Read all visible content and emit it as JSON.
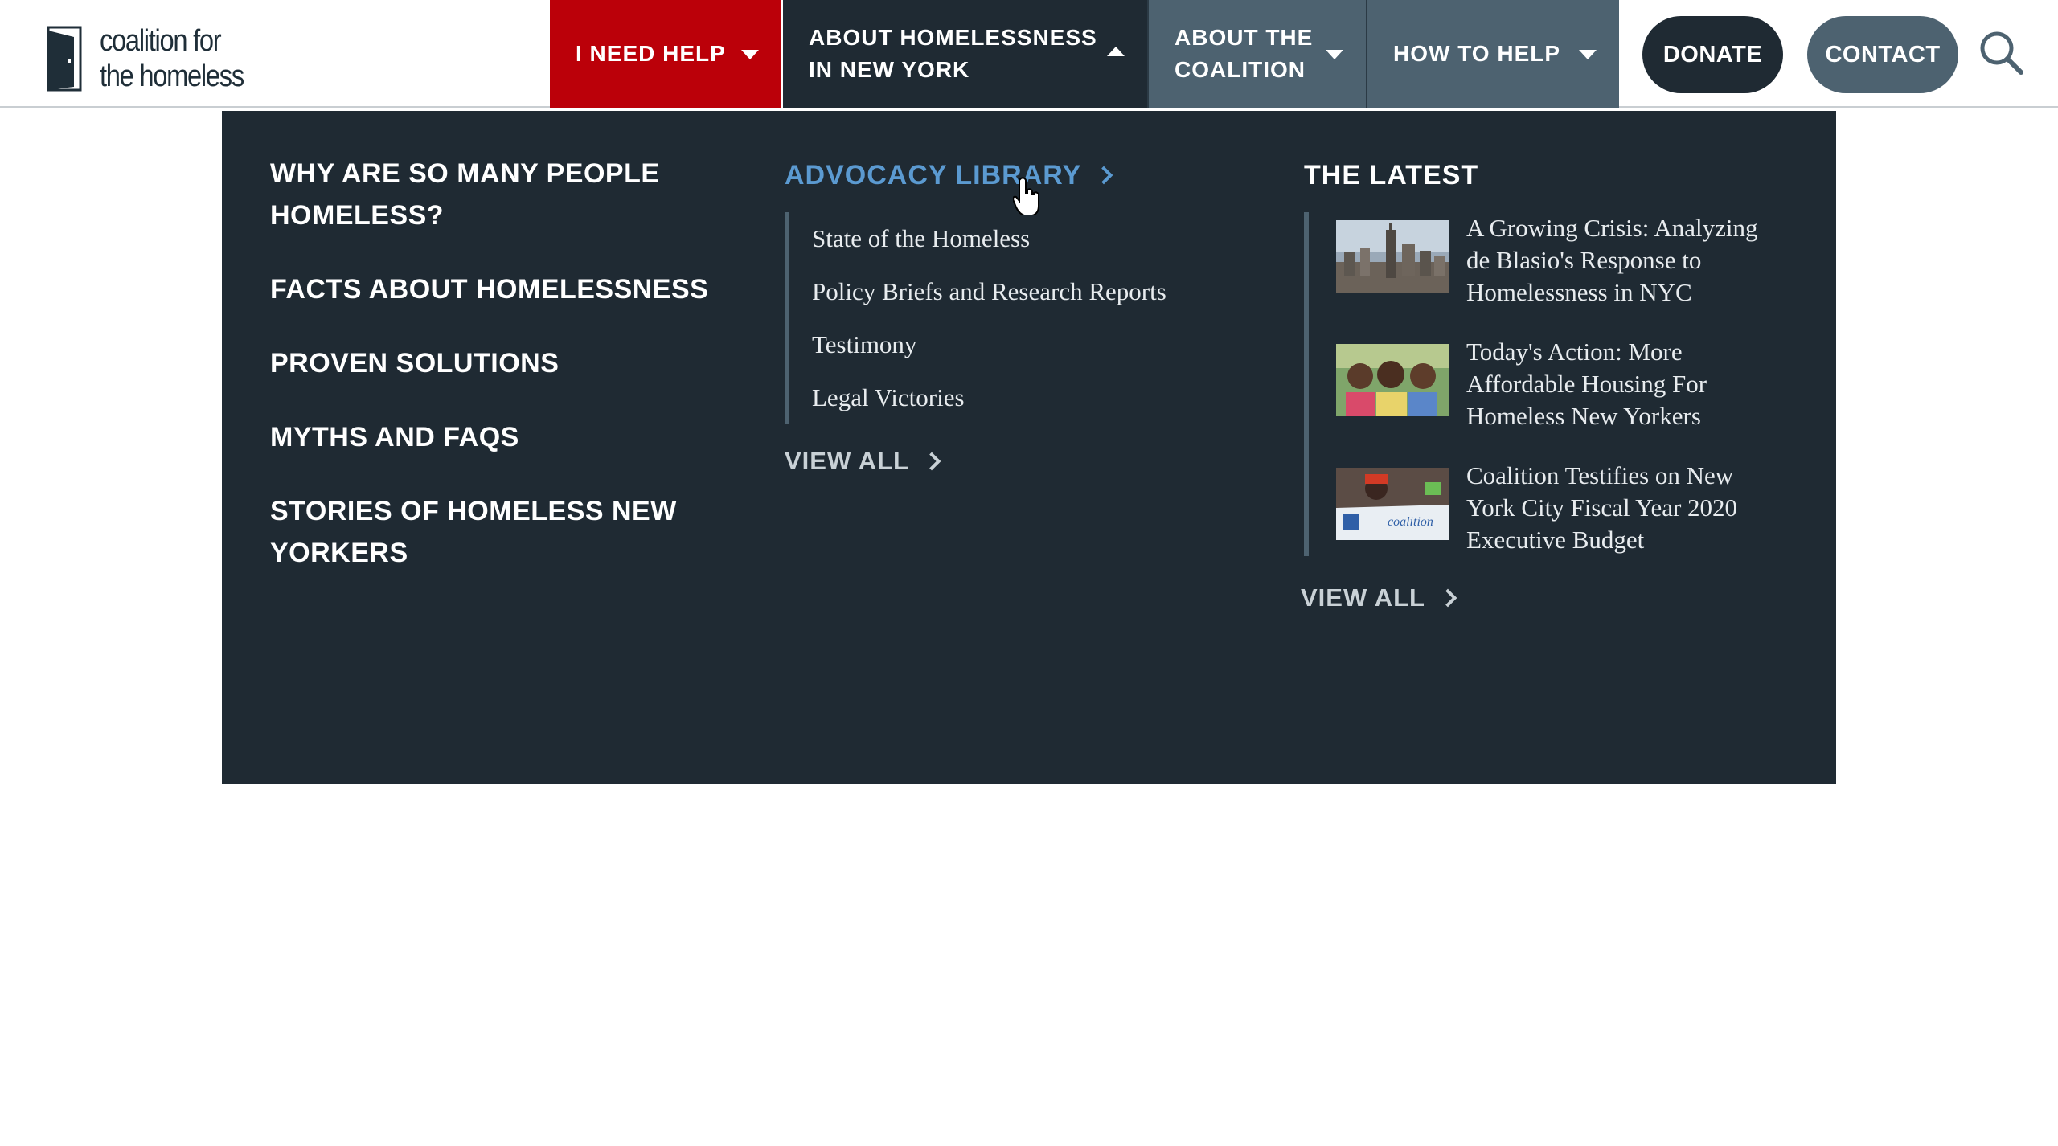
{
  "brand": {
    "logo_line1": "coalition for",
    "logo_line2": "the homeless"
  },
  "nav": {
    "tabs": [
      {
        "label": "I NEED HELP"
      },
      {
        "label_line1": "ABOUT HOMELESSNESS",
        "label_line2": "IN NEW YORK"
      },
      {
        "label_line1": "ABOUT THE",
        "label_line2": "COALITION"
      },
      {
        "label": "HOW TO HELP"
      }
    ],
    "donate": "DONATE",
    "contact": "CONTACT"
  },
  "colors": {
    "help_red": "#bb0009",
    "dark": "#1f2a33",
    "slate": "#4d6270",
    "link_blue": "#5b9ad1"
  },
  "mega_menu": {
    "left_links": [
      "WHY ARE SO MANY PEOPLE HOMELESS?",
      "FACTS ABOUT HOMELESSNESS",
      "PROVEN SOLUTIONS",
      "MYTHS AND FAQS",
      "STORIES OF HOMELESS NEW YORKERS"
    ],
    "advocacy": {
      "heading": "ADVOCACY LIBRARY",
      "items": [
        "State of the Homeless",
        "Policy Briefs and Research Reports",
        "Testimony",
        "Legal Victories"
      ],
      "view_all": "VIEW ALL"
    },
    "latest": {
      "heading": "THE LATEST",
      "items": [
        {
          "title": "A Growing Crisis: Analyzing de Blasio's Response to Homelessness in NYC",
          "thumb": "city-skyline-image"
        },
        {
          "title": "Today's Action: More Affordable Housing For Homeless New Yorkers",
          "thumb": "children-photo"
        },
        {
          "title": "Coalition Testifies on New York City Fiscal Year 2020 Executive Budget",
          "thumb": "rally-sign-photo",
          "thumb_text": "coalition"
        }
      ],
      "view_all": "VIEW ALL"
    }
  }
}
